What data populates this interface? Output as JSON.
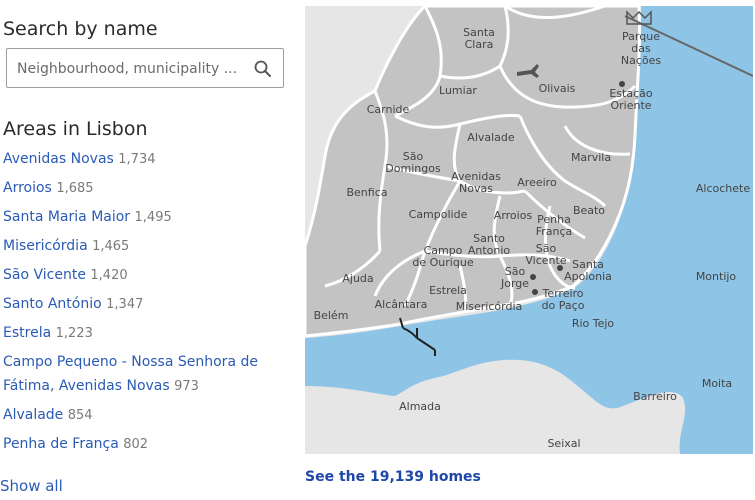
{
  "search": {
    "title": "Search by name",
    "placeholder": "Neighbourhood, municipality ..."
  },
  "areas": {
    "title": "Areas in Lisbon",
    "items": [
      {
        "name": "Avenidas Novas",
        "count": "1,734"
      },
      {
        "name": "Arroios",
        "count": "1,685"
      },
      {
        "name": "Santa Maria Maior",
        "count": "1,495"
      },
      {
        "name": "Misericórdia",
        "count": "1,465"
      },
      {
        "name": "São Vicente",
        "count": "1,420"
      },
      {
        "name": "Santo António",
        "count": "1,347"
      },
      {
        "name": "Estrela",
        "count": "1,223"
      },
      {
        "name": "Campo Pequeno - Nossa Senhora de Fátima, Avenidas Novas",
        "count": "973"
      },
      {
        "name": "Alvalade",
        "count": "854"
      },
      {
        "name": "Penha de França",
        "count": "802"
      }
    ],
    "show_all": "Show all"
  },
  "map": {
    "labels": {
      "santa_clara": [
        "Santa",
        "Clara"
      ],
      "parque_nacoes": [
        "Parque",
        "das",
        "Nações"
      ],
      "lumiar": "Lumiar",
      "olivais": "Olivais",
      "estacao_oriente": [
        "Estação",
        "Oriente"
      ],
      "carnide": "Carnide",
      "alvalade": "Alvalade",
      "sao_domingos": [
        "São",
        "Domingos"
      ],
      "marvila": "Marvila",
      "alcochete": "Alcochete",
      "benfica": "Benfica",
      "avenidas_novas": [
        "Avenidas",
        "Novas"
      ],
      "areeiro": "Areeiro",
      "campolide": "Campolide",
      "arroios": "Arroios",
      "penha_franca": [
        "Penha",
        "França"
      ],
      "beato": "Beato",
      "campo_ourique": [
        "Campo",
        "de Ourique"
      ],
      "santo_antonio": [
        "Santo",
        "Antonio"
      ],
      "sao_vicente": [
        "São",
        "Vicente"
      ],
      "santa_apolonia": [
        "Santa",
        "Apolonia"
      ],
      "ajuda": "Ajuda",
      "estrela": "Estrela",
      "sao_jorge": [
        "São",
        "Jorge"
      ],
      "terreiro_paco": [
        "Terreiro",
        "do Paço"
      ],
      "montijo": "Montijo",
      "alcantara": "Alcântara",
      "misericordia": "Misericórdia",
      "rio_tejo": "Rio Tejo",
      "belem": "Belém",
      "moita": "Moita",
      "barreiro": "Barreiro",
      "almada": "Almada",
      "seixal": "Seixal"
    },
    "colors": {
      "water": "#8ec4e6",
      "land": "#e6e6e6",
      "district": "#c3c3c3",
      "border": "#ffffff"
    }
  },
  "cta": {
    "see_homes": "See the 19,139 homes"
  }
}
